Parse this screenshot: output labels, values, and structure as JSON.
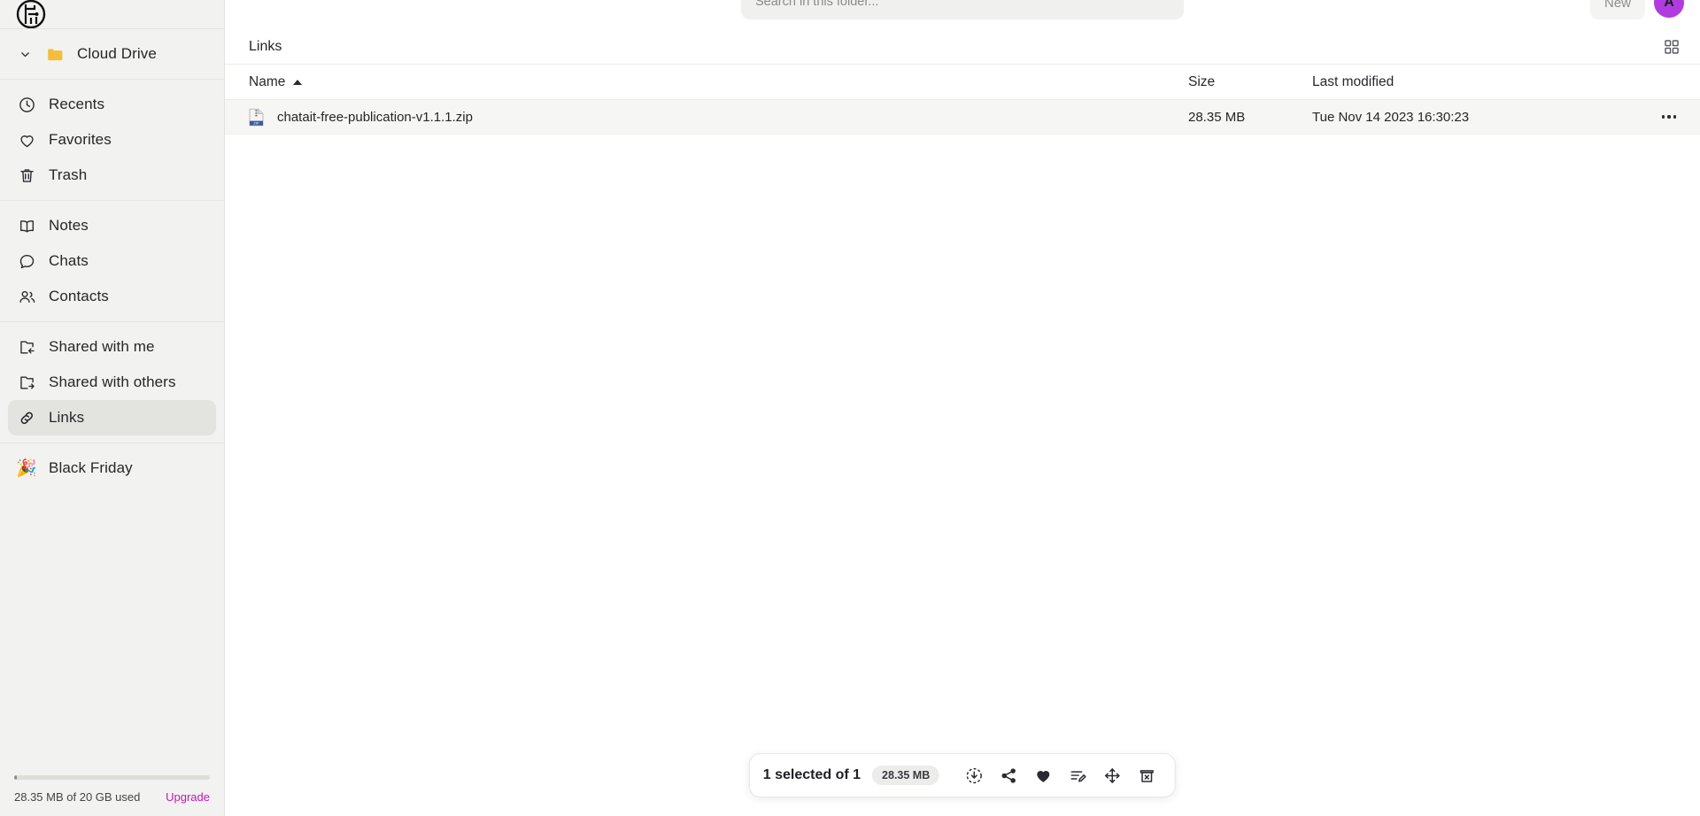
{
  "app": {
    "logo_name": "filecloud-logo",
    "accent_purple": "#b03ce0",
    "upgrade_color": "#c01ab3",
    "sidebar_bg": "#f2f2f0"
  },
  "sidebar": {
    "drive": {
      "label": "Cloud Drive",
      "icon": "folder-icon",
      "chevron": "chevron-down-icon"
    },
    "group_library": [
      {
        "label": "Recents",
        "icon": "clock-icon",
        "active": false
      },
      {
        "label": "Favorites",
        "icon": "heart-icon",
        "active": false
      },
      {
        "label": "Trash",
        "icon": "trash-icon",
        "active": false
      }
    ],
    "group_apps": [
      {
        "label": "Notes",
        "icon": "book-icon",
        "active": false
      },
      {
        "label": "Chats",
        "icon": "chat-icon",
        "active": false
      },
      {
        "label": "Contacts",
        "icon": "contacts-icon",
        "active": false
      }
    ],
    "group_sharing": [
      {
        "label": "Shared with me",
        "icon": "folder-in-icon",
        "active": false
      },
      {
        "label": "Shared with others",
        "icon": "folder-out-icon",
        "active": false
      },
      {
        "label": "Links",
        "icon": "link-icon",
        "active": true
      }
    ],
    "group_promo": [
      {
        "label": "Black Friday",
        "icon": "party-popper-icon",
        "emoji": "🎉",
        "active": false
      }
    ],
    "storage": {
      "text": "28.35 MB of 20 GB used",
      "upgrade_label": "Upgrade",
      "percent_used": 0.14
    }
  },
  "header": {
    "search": {
      "placeholder": "Search in this folder...",
      "value": ""
    },
    "new_button": "New",
    "avatar_initial": "A"
  },
  "content": {
    "breadcrumb_title": "Links",
    "view_toggle_icon": "grid-view-icon",
    "columns": {
      "name": "Name",
      "size": "Size",
      "modified": "Last modified"
    },
    "sort": {
      "column": "Name",
      "direction": "ascending"
    },
    "rows": [
      {
        "name": "chatait-free-publication-v1.1.1.zip",
        "icon": "zip-file-icon",
        "size": "28.35 MB",
        "modified": "Tue Nov 14 2023 16:30:23",
        "selected": true
      }
    ]
  },
  "selection_toolbar": {
    "count_label": "1 selected of 1",
    "size_badge": "28.35 MB",
    "actions": [
      {
        "name": "download-button",
        "icon": "download-icon"
      },
      {
        "name": "share-button",
        "icon": "share-nodes-icon"
      },
      {
        "name": "favorite-button",
        "icon": "heart-filled-icon"
      },
      {
        "name": "rename-button",
        "icon": "rename-pencil-icon"
      },
      {
        "name": "move-button",
        "icon": "move-arrows-icon"
      },
      {
        "name": "delete-button",
        "icon": "trash-x-icon"
      }
    ]
  }
}
